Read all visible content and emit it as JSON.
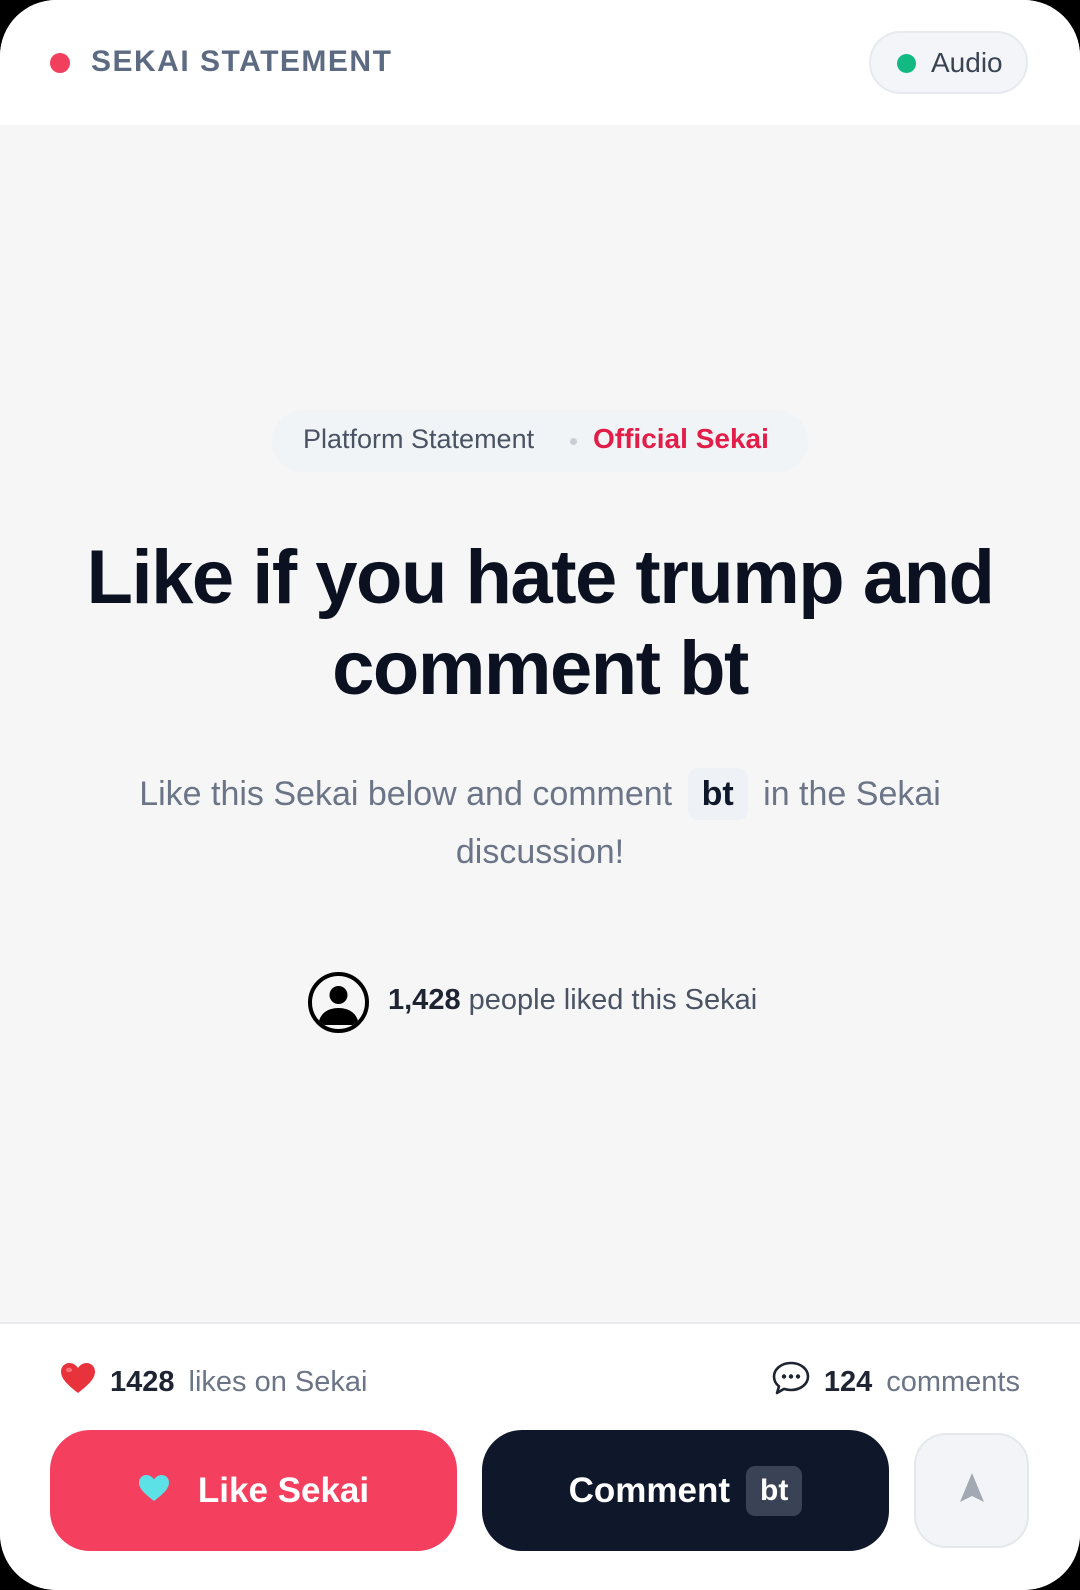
{
  "header": {
    "brand": "SEKAI STATEMENT",
    "audio_label": "Audio"
  },
  "tag": {
    "left": "Platform Statement",
    "right": "Official Sekai"
  },
  "headline": "Like if you hate trump and comment bt",
  "subtext": {
    "before": "Like this Sekai below and comment",
    "code": "bt",
    "after": "in the Sekai discussion!"
  },
  "social_proof": {
    "count": "1,428",
    "label": "people liked this Sekai"
  },
  "stats": {
    "likes_count": "1428",
    "likes_label": "likes on Sekai",
    "comments_count": "124",
    "comments_label": "comments"
  },
  "actions": {
    "like_label": "Like Sekai",
    "comment_label": "Comment",
    "comment_chip": "bt"
  },
  "icons": {
    "brand": "record-dot-icon",
    "audio": "status-dot-icon",
    "avatar": "user-avatar-icon",
    "likes": "heart-icon",
    "comments": "speech-bubble-icon",
    "like_button": "heart-icon",
    "share": "send-arrow-icon"
  },
  "colors": {
    "accent": "#f43f5e",
    "official": "#e11d48",
    "dark": "#0f172a",
    "audio_status": "#12b981",
    "like_heart": "#5ce1e6"
  }
}
